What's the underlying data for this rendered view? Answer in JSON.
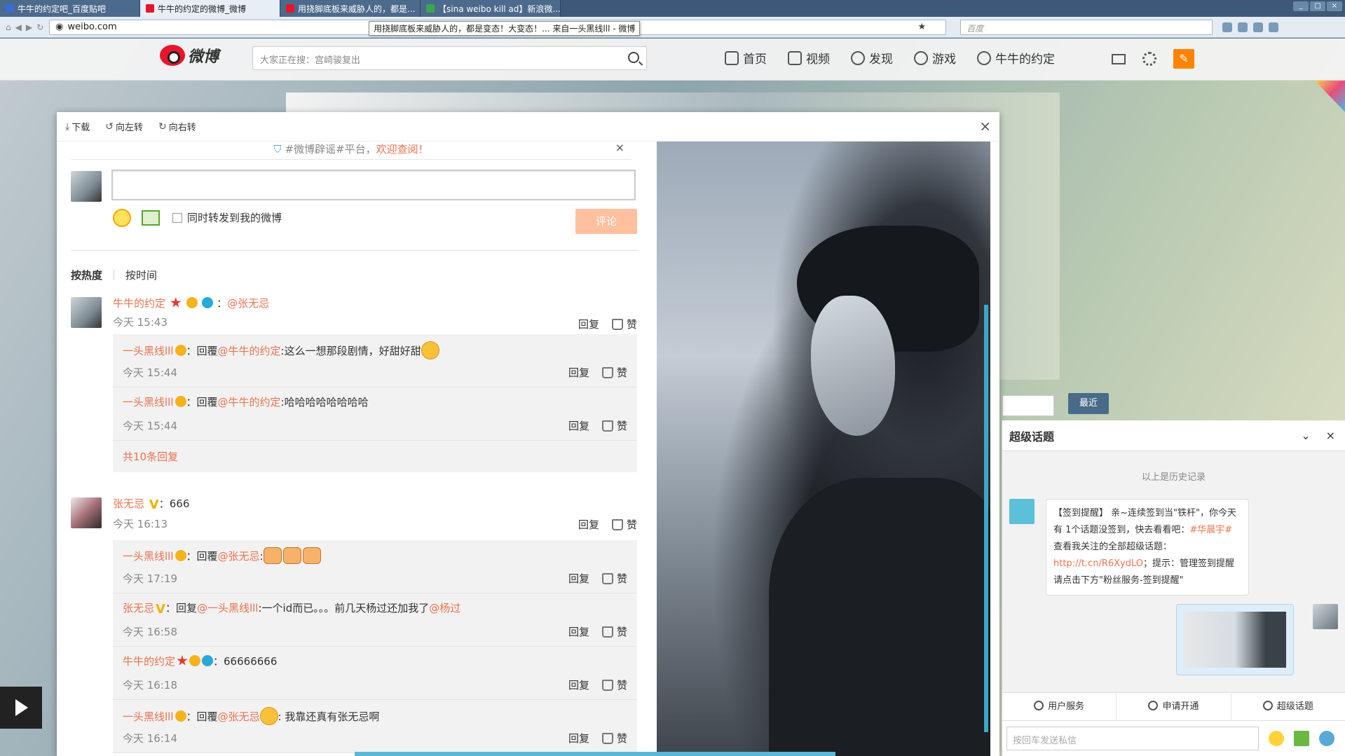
{
  "browser": {
    "tabs": [
      {
        "label": "牛牛的约定吧_百度贴吧",
        "active": false
      },
      {
        "label": "牛牛的约定的微博_微博",
        "active": true
      },
      {
        "label": "用挠脚底板来威胁人的，都是...",
        "active": false
      },
      {
        "label": "【sina weibo kill ad】新浪微...",
        "active": false
      }
    ],
    "url": "weibo.com",
    "tooltip": "用挠脚底板来威胁人的，都是变态！大变态！... 来自一头黑线lll - 微博",
    "search_placeholder": "百度"
  },
  "weibo_nav": {
    "logo_text": "微博",
    "search_placeholder": "大家正在搜：宫崎骏复出",
    "links": [
      "首页",
      "视频",
      "发现",
      "游戏",
      "牛牛的约定"
    ]
  },
  "viewer": {
    "toolbar": {
      "download": "下载",
      "rotate_left": "向左转",
      "rotate_right": "向右转"
    },
    "notice": {
      "prefix": "#微博辟谣#平台，",
      "highlight": "欢迎查阅！"
    },
    "compose": {
      "forward_label": "同时转发到我的微博",
      "submit": "评论"
    },
    "sort": {
      "hot": "按热度",
      "time": "按时间"
    },
    "comments": [
      {
        "user": "牛牛的约定",
        "text": "：",
        "at": "@张无忌",
        "time": "今天 15:43",
        "replies": [
          {
            "user": "一头黑线lll",
            "prefix": "：回覆",
            "at": "@牛牛的约定",
            "text": ":这么一想那段剧情，好甜好甜",
            "time": "今天 15:44"
          },
          {
            "user": "一头黑线lll",
            "prefix": "：回覆",
            "at": "@牛牛的约定",
            "text": ":哈哈哈哈哈哈哈哈",
            "time": "今天 15:44"
          }
        ],
        "more": "共10条回复"
      },
      {
        "user": "张无忌",
        "text": "：666",
        "time": "今天 16:13",
        "replies": [
          {
            "user": "一头黑线lll",
            "prefix": "：回覆",
            "at": "@张无忌",
            "text": ":",
            "time": "今天 17:19"
          },
          {
            "user": "张无忌",
            "prefix": "：回复",
            "at": "@一头黑线lll",
            "text": ":一个id而已。。。前几天杨过还加我了",
            "at2": "@杨过",
            "time": "今天 16:58"
          },
          {
            "user": "牛牛的约定",
            "prefix": "：66666666",
            "at": "",
            "text": "",
            "time": "今天 16:18"
          },
          {
            "user": "一头黑线lll",
            "prefix": "：回覆",
            "at": "@张无忌",
            "text": ": 我靠还真有张无忌啊",
            "time": "今天 16:14"
          }
        ]
      }
    ],
    "reply_label": "回复",
    "like_label": "赞"
  },
  "chat": {
    "title": "超级话题",
    "history": "以上是历史记录",
    "message": {
      "part1": "【签到提醒】 亲~连续签到当\"铁杆\"，你今天有 1个话题没签到，快去看看吧：",
      "link1": "#华晨宇#",
      "part2": " 查看我关注的全部超级话题：",
      "link2": "http://t.cn/R6XydLO",
      "part3": "；提示：管理签到提醒请点击下方\"粉丝服务-签到提醒\""
    },
    "menu": [
      "用户服务",
      "申请开通",
      "超级话题"
    ],
    "input_placeholder": "按回车发送私信"
  },
  "recent_tab": "最近"
}
